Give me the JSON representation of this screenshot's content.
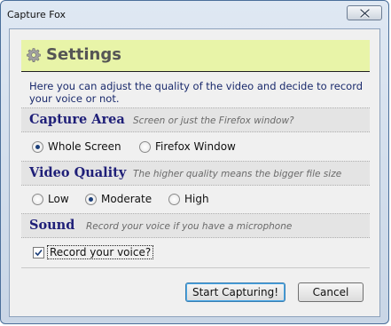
{
  "window": {
    "title": "Capture Fox"
  },
  "header": {
    "title": "Settings",
    "icon": "gear-icon"
  },
  "intro_text": "Here you can adjust the quality of the video and decide to record your voice or not.",
  "sections": {
    "capture_area": {
      "title": "Capture Area",
      "hint": "Screen or just the Firefox window?",
      "options": [
        {
          "label": "Whole Screen",
          "checked": true
        },
        {
          "label": "Firefox Window",
          "checked": false
        }
      ]
    },
    "video_quality": {
      "title": "Video Quality",
      "hint": "The higher quality means the bigger file size",
      "options": [
        {
          "label": "Low",
          "checked": false
        },
        {
          "label": "Moderate",
          "checked": true
        },
        {
          "label": "High",
          "checked": false
        }
      ]
    },
    "sound": {
      "title": "Sound",
      "hint": "Record your voice if you have a microphone",
      "checkbox_label": "Record your voice?",
      "checked": true
    }
  },
  "buttons": {
    "start": "Start Capturing!",
    "cancel": "Cancel"
  },
  "colors": {
    "banner": "#e8f4a8",
    "section_title": "#1f1f78",
    "intro_text": "#1a2a6c"
  }
}
